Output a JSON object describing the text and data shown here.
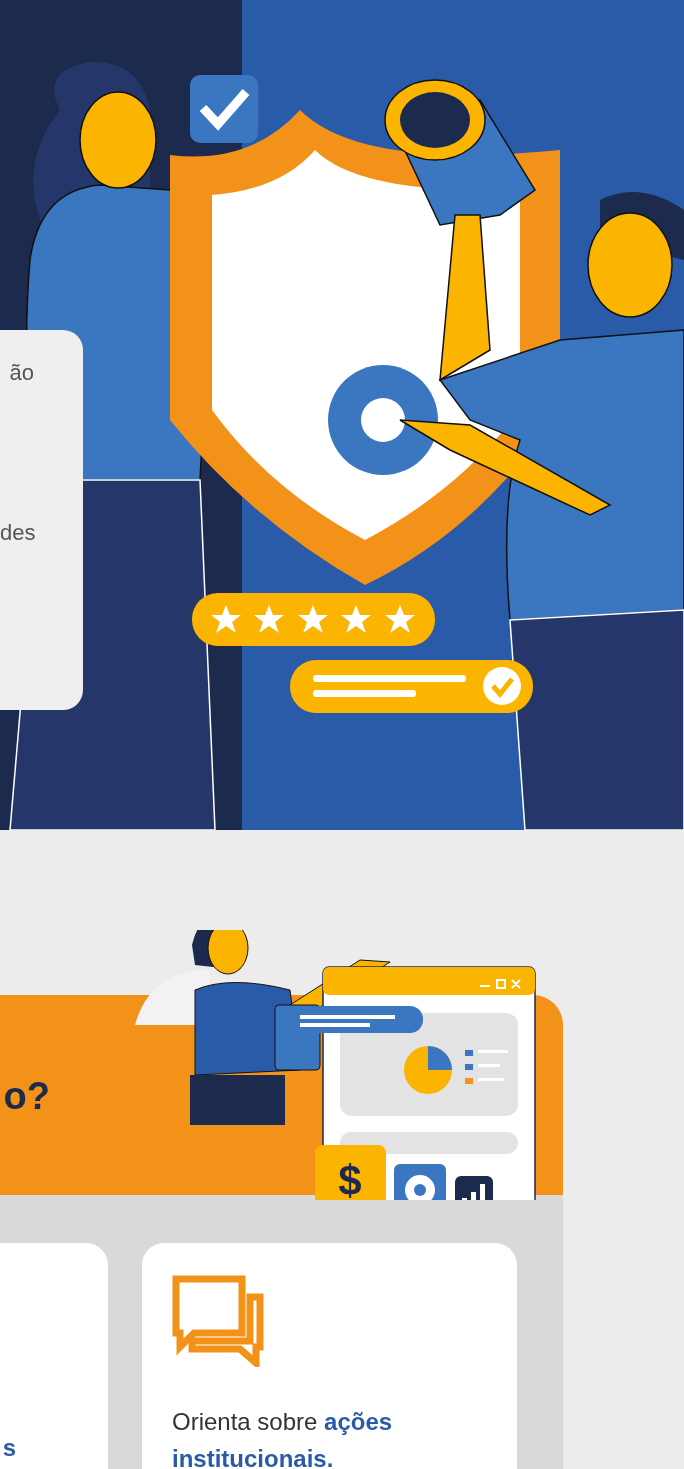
{
  "hero": {
    "card_lines": [
      "ão",
      "des"
    ]
  },
  "banner": {
    "heading": "o?",
    "dollar_tile": "$"
  },
  "cards": [
    {
      "kind": "cut",
      "text": "s"
    },
    {
      "kind": "chat",
      "text": "Orienta sobre **ações institucionais.**"
    }
  ]
}
